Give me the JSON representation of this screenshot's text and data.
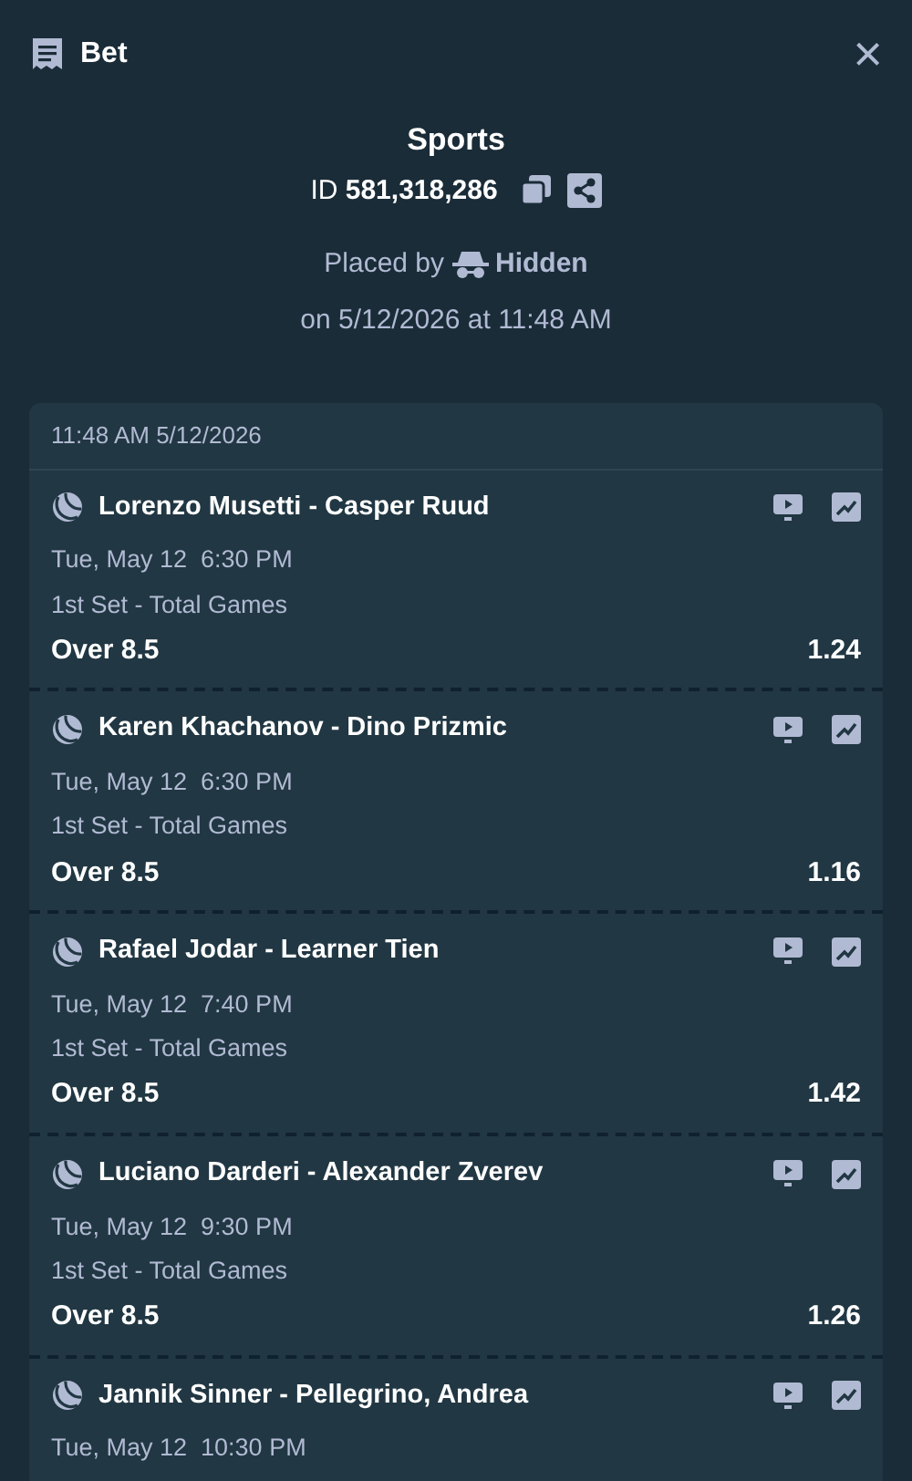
{
  "header": {
    "title": "Bet",
    "close": "×"
  },
  "summary": {
    "category": "Sports",
    "id_label": "ID",
    "id_value": "581,318,286",
    "placed_by_label": "Placed by",
    "placed_by": "Hidden",
    "placed_on": "on 5/12/2026 at 11:48 AM"
  },
  "slip": {
    "timestamp": "11:48 AM 5/12/2026",
    "legs": [
      {
        "match": "Lorenzo Musetti - Casper Ruud",
        "date": "Tue, May 12  6:30 PM",
        "market": "1st Set - Total Games",
        "selection": "Over 8.5",
        "odds": "1.24"
      },
      {
        "match": "Karen Khachanov - Dino Prizmic",
        "date": "Tue, May 12  6:30 PM",
        "market": "1st Set - Total Games",
        "selection": "Over 8.5",
        "odds": "1.16"
      },
      {
        "match": "Rafael Jodar - Learner Tien",
        "date": "Tue, May 12  7:40 PM",
        "market": "1st Set - Total Games",
        "selection": "Over 8.5",
        "odds": "1.42"
      },
      {
        "match": "Luciano Darderi - Alexander Zverev",
        "date": "Tue, May 12  9:30 PM",
        "market": "1st Set - Total Games",
        "selection": "Over 8.5",
        "odds": "1.26"
      },
      {
        "match": "Jannik Sinner - Pellegrino, Andrea",
        "date": "Tue, May 12  10:30 PM"
      }
    ]
  }
}
